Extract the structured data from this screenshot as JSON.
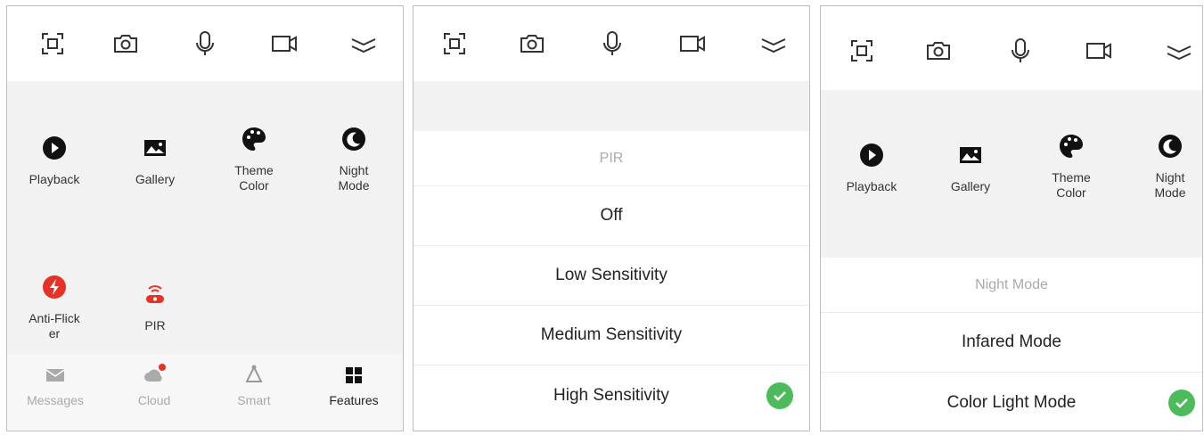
{
  "colors": {
    "accent_red": "#e53226",
    "check_green": "#4cbb5c",
    "sheet_bg": "#f2f2f2"
  },
  "toolbar": {
    "icons": [
      "fullscreen-icon",
      "camera-icon",
      "microphone-icon",
      "video-record-icon",
      "collapse-chevrons-icon"
    ]
  },
  "panel1": {
    "features": [
      {
        "label": "Playback",
        "icon": "play-circle-icon"
      },
      {
        "label": "Gallery",
        "icon": "gallery-icon"
      },
      {
        "label": "Theme\nColor",
        "icon": "palette-icon"
      },
      {
        "label": "Night\nMode",
        "icon": "moon-icon"
      },
      {
        "label": "Anti-Flick\ner",
        "icon": "lightning-icon"
      },
      {
        "label": "PIR",
        "icon": "pir-sensor-icon"
      }
    ],
    "tabs": [
      {
        "label": "Messages",
        "icon": "envelope-icon"
      },
      {
        "label": "Cloud",
        "icon": "cloud-icon"
      },
      {
        "label": "Smart",
        "icon": "smart-icon"
      },
      {
        "label": "Features",
        "icon": "grid-icon",
        "active": true
      }
    ]
  },
  "panel2": {
    "sheet_title": "PIR",
    "options": [
      {
        "label": "Off",
        "selected": false
      },
      {
        "label": "Low Sensitivity",
        "selected": false
      },
      {
        "label": "Medium Sensitivity",
        "selected": false
      },
      {
        "label": "High Sensitivity",
        "selected": true
      }
    ]
  },
  "panel3": {
    "features": [
      {
        "label": "Playback",
        "icon": "play-circle-icon"
      },
      {
        "label": "Gallery",
        "icon": "gallery-icon"
      },
      {
        "label": "Theme\nColor",
        "icon": "palette-icon"
      },
      {
        "label": "Night\nMode",
        "icon": "moon-icon"
      }
    ],
    "sheet_title": "Night Mode",
    "options": [
      {
        "label": "Infared Mode",
        "selected": false
      },
      {
        "label": "Color Light Mode",
        "selected": true
      }
    ]
  }
}
